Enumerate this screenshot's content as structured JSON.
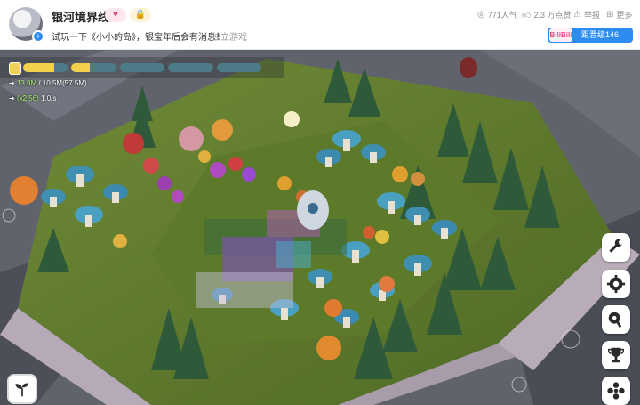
{
  "header": {
    "title": "银河境界线",
    "badge_heart": "♥",
    "badge_lock": "🔒",
    "subtitle": "试玩一下《小小的岛》，银宝年后会有消息！",
    "indie_tag": "独立游戏",
    "stats": {
      "popularity": "771人气",
      "likes": "2.3 万点赞",
      "report": "举报",
      "more": "更多"
    },
    "level_logo": "BiliBili",
    "level_label": "距晋级146"
  },
  "game": {
    "resource_line_1_value": "13.9M",
    "resource_line_1_rest": "/ 10.5M(57.5M)",
    "resource_line_2_value": "(x2.56)",
    "resource_line_2_rest": "1.0/s",
    "progress_segments": [
      0.7,
      0.4,
      0.0,
      0.0,
      0.0
    ],
    "icons": [
      "wrench-icon",
      "gear-icon",
      "map-pin-icon",
      "trophy-icon",
      "flower-icon",
      "sprout-icon"
    ]
  }
}
